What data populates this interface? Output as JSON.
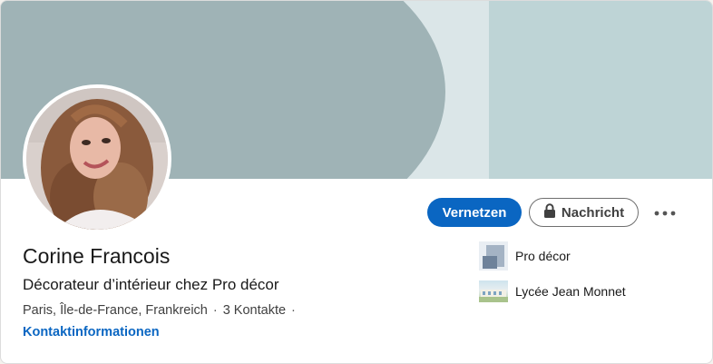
{
  "profile": {
    "name": "Corine Francois",
    "headline": "Décorateur d’intérieur chez Pro décor",
    "location": "Paris, Île-de-France, Frankreich",
    "separator": "·",
    "connections": "3 Kontakte",
    "contact_info_label": "Kontaktinformationen"
  },
  "actions": {
    "connect_label": "Vernetzen",
    "message_label": "Nachricht",
    "more_label": "···"
  },
  "highlights": {
    "company": "Pro décor",
    "school": "Lycée Jean Monnet"
  },
  "icons": {
    "lock": "lock-icon",
    "more": "more-icon",
    "company_logo": "company-logo",
    "school_logo": "school-logo"
  },
  "colors": {
    "accent": "#0a66c2",
    "cover_dark": "#9fb3b6",
    "cover_light": "#bed4d6"
  }
}
